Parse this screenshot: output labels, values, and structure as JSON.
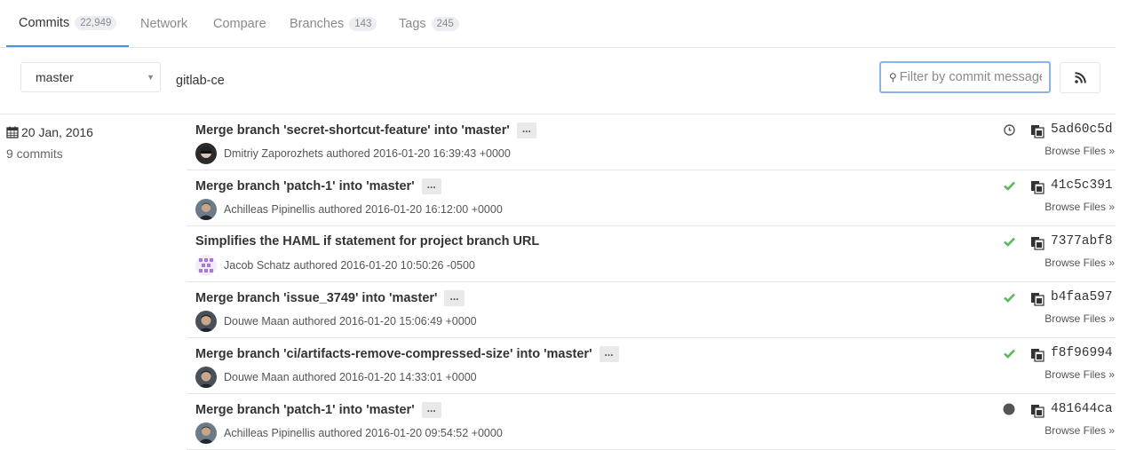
{
  "tabs": [
    {
      "label": "Commits",
      "badge": "22,949"
    },
    {
      "label": "Network"
    },
    {
      "label": "Compare"
    },
    {
      "label": "Branches",
      "badge": "143"
    },
    {
      "label": "Tags",
      "badge": "245"
    }
  ],
  "toolbar": {
    "branch_select": "master",
    "project_name": "gitlab-ce",
    "search_placeholder": "Filter by commit message",
    "rss_icon": "rss-icon"
  },
  "day_group": {
    "date": "20 Jan, 2016",
    "count": "9 commits"
  },
  "colors": {
    "success": "#5cb85c",
    "running": "#555555",
    "active_tab_underline": "#4a90e2"
  },
  "commits": [
    {
      "title": "Merge branch 'secret-shortcut-feature' into 'master'",
      "has_more": true,
      "author": "Dmitriy Zaporozhets",
      "authored": "authored 2016-01-20 16:39:43 +0000",
      "status": "pending",
      "sha": "5ad60c5d",
      "browse": "Browse Files »"
    },
    {
      "title": "Merge branch 'patch-1' into 'master'",
      "has_more": true,
      "author": "Achilleas Pipinellis",
      "authored": "authored 2016-01-20 16:12:00 +0000",
      "status": "success",
      "sha": "41c5c391",
      "browse": "Browse Files »"
    },
    {
      "title": "Simplifies the HAML if statement for project branch URL",
      "has_more": false,
      "author": "Jacob Schatz",
      "authored": "authored 2016-01-20 10:50:26 -0500",
      "status": "success",
      "sha": "7377abf8",
      "browse": "Browse Files »"
    },
    {
      "title": "Merge branch 'issue_3749' into 'master'",
      "has_more": true,
      "author": "Douwe Maan",
      "authored": "authored 2016-01-20 15:06:49 +0000",
      "status": "success",
      "sha": "b4faa597",
      "browse": "Browse Files »"
    },
    {
      "title": "Merge branch 'ci/artifacts-remove-compressed-size' into 'master'",
      "has_more": true,
      "author": "Douwe Maan",
      "authored": "authored 2016-01-20 14:33:01 +0000",
      "status": "success",
      "sha": "f8f96994",
      "browse": "Browse Files »"
    },
    {
      "title": "Merge branch 'patch-1' into 'master'",
      "has_more": true,
      "author": "Achilleas Pipinellis",
      "authored": "authored 2016-01-20 09:54:52 +0000",
      "status": "running",
      "sha": "481644ca",
      "browse": "Browse Files »"
    }
  ],
  "ellipsis_label": "..."
}
